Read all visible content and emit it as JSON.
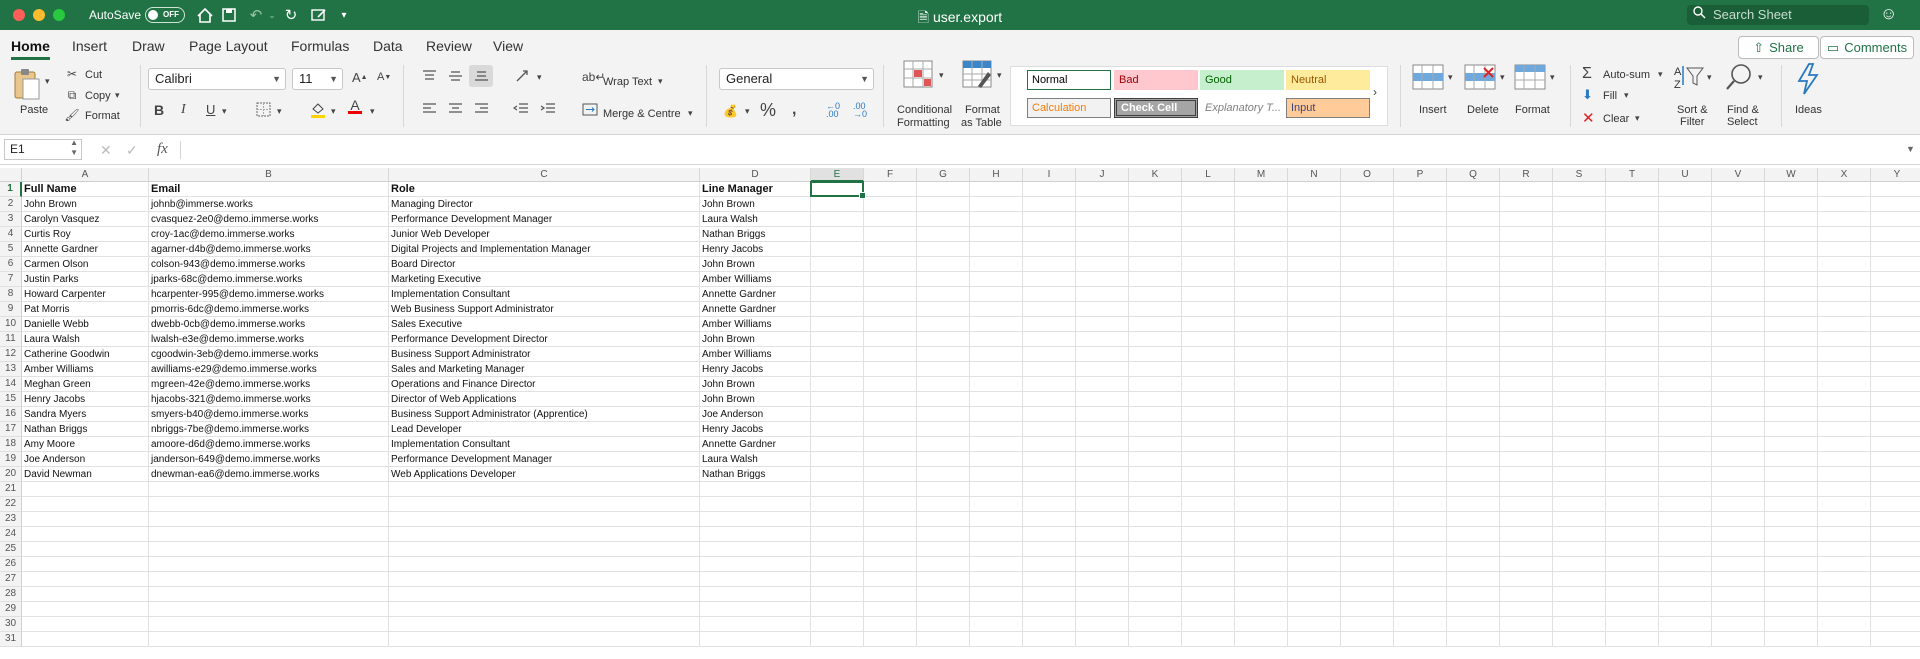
{
  "titlebar": {
    "autosave_label": "AutoSave",
    "autosave_state": "OFF",
    "doc_title": "user.export",
    "search_placeholder": "Search Sheet"
  },
  "tabs": [
    "Home",
    "Insert",
    "Draw",
    "Page Layout",
    "Formulas",
    "Data",
    "Review",
    "View"
  ],
  "active_tab": "Home",
  "share_label": "Share",
  "comments_label": "Comments",
  "ribbon": {
    "paste": "Paste",
    "cut": "Cut",
    "copy": "Copy",
    "format_painter": "Format",
    "font_name": "Calibri",
    "font_size": "11",
    "bold": "B",
    "italic": "I",
    "underline": "U",
    "wrap_text": "Wrap Text",
    "merge_centre": "Merge & Centre",
    "number_format": "General",
    "conditional_formatting_1": "Conditional",
    "conditional_formatting_2": "Formatting",
    "format_as_table_1": "Format",
    "format_as_table_2": "as Table",
    "styles": {
      "normal": "Normal",
      "bad": "Bad",
      "good": "Good",
      "neutral": "Neutral",
      "calculation": "Calculation",
      "check_cell": "Check Cell",
      "explanatory": "Explanatory T...",
      "input": "Input"
    },
    "insert": "Insert",
    "delete": "Delete",
    "format": "Format",
    "autosum": "Auto-sum",
    "fill": "Fill",
    "clear": "Clear",
    "sort_filter_1": "Sort &",
    "sort_filter_2": "Filter",
    "find_select_1": "Find &",
    "find_select_2": "Select",
    "ideas": "Ideas"
  },
  "formula_bar": {
    "name_box": "E1",
    "fx": "fx",
    "value": ""
  },
  "columns": [
    "A",
    "B",
    "C",
    "D",
    "E",
    "F",
    "G",
    "H",
    "I",
    "J",
    "K",
    "L",
    "M",
    "N",
    "O",
    "P",
    "Q",
    "R",
    "S",
    "T",
    "U",
    "V",
    "W",
    "X",
    "Y"
  ],
  "row_numbers": [
    "1",
    "2",
    "3",
    "4",
    "5",
    "6",
    "7",
    "8",
    "9",
    "10",
    "11",
    "12",
    "13",
    "14",
    "15",
    "16",
    "17",
    "18",
    "19",
    "20",
    "21",
    "22",
    "23",
    "24",
    "25",
    "26",
    "27",
    "28",
    "29",
    "30",
    "31"
  ],
  "sheet": {
    "headers": [
      "Full Name",
      "Email",
      "Role",
      "Line Manager"
    ],
    "rows": [
      [
        "John Brown",
        "johnb@immerse.works",
        "Managing Director",
        "John Brown"
      ],
      [
        "Carolyn Vasquez",
        "cvasquez-2e0@demo.immerse.works",
        "Performance Development Manager",
        "Laura Walsh"
      ],
      [
        "Curtis Roy",
        "croy-1ac@demo.immerse.works",
        "Junior Web Developer",
        "Nathan Briggs"
      ],
      [
        "Annette Gardner",
        "agarner-d4b@demo.immerse.works",
        "Digital Projects and Implementation Manager",
        "Henry Jacobs"
      ],
      [
        "Carmen Olson",
        "colson-943@demo.immerse.works",
        "Board Director",
        "John Brown"
      ],
      [
        "Justin Parks",
        "jparks-68c@demo.immerse.works",
        "Marketing Executive",
        "Amber Williams"
      ],
      [
        "Howard Carpenter",
        "hcarpenter-995@demo.immerse.works",
        "Implementation Consultant",
        "Annette Gardner"
      ],
      [
        "Pat Morris",
        "pmorris-6dc@demo.immerse.works",
        "Web Business Support Administrator",
        "Annette Gardner"
      ],
      [
        "Danielle Webb",
        "dwebb-0cb@demo.immerse.works",
        "Sales Executive",
        "Amber Williams"
      ],
      [
        "Laura Walsh",
        "lwalsh-e3e@demo.immerse.works",
        "Performance Development Director",
        "John Brown"
      ],
      [
        "Catherine Goodwin",
        "cgoodwin-3eb@demo.immerse.works",
        "Business Support Administrator",
        "Amber Williams"
      ],
      [
        "Amber Williams",
        "awilliams-e29@demo.immerse.works",
        "Sales and Marketing Manager",
        "Henry Jacobs"
      ],
      [
        "Meghan Green",
        "mgreen-42e@demo.immerse.works",
        "Operations and Finance Director",
        "John Brown"
      ],
      [
        "Henry Jacobs",
        "hjacobs-321@demo.immerse.works",
        "Director of Web Applications",
        "John Brown"
      ],
      [
        "Sandra Myers",
        "smyers-b40@demo.immerse.works",
        "Business Support Administrator (Apprentice)",
        "Joe Anderson"
      ],
      [
        "Nathan Briggs",
        "nbriggs-7be@demo.immerse.works",
        "Lead Developer",
        "Henry Jacobs"
      ],
      [
        "Amy Moore",
        "amoore-d6d@demo.immerse.works",
        "Implementation Consultant",
        "Annette Gardner"
      ],
      [
        "Joe Anderson",
        "janderson-649@demo.immerse.works",
        "Performance Development Manager",
        "Laura Walsh"
      ],
      [
        "David Newman",
        "dnewman-ea6@demo.immerse.works",
        "Web Applications Developer",
        "Nathan Briggs"
      ]
    ]
  },
  "colors": {
    "brand": "#217346"
  }
}
